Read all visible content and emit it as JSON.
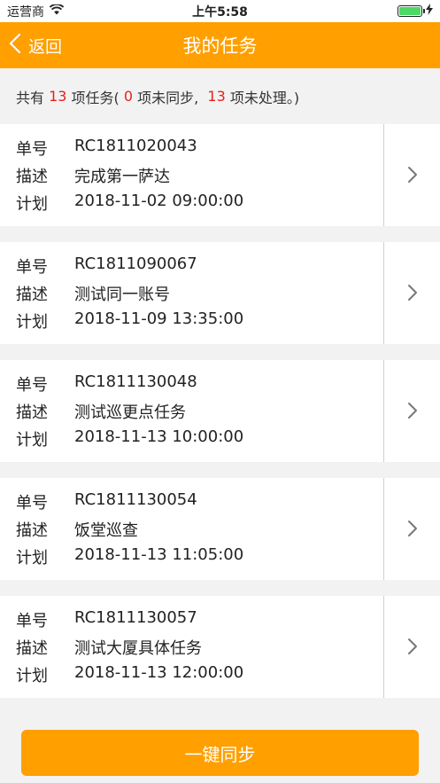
{
  "status_bar": {
    "carrier": "运营商",
    "time": "上午5:58"
  },
  "nav": {
    "back_label": "返回",
    "title": "我的任务"
  },
  "summary": {
    "prefix": "共有 ",
    "total": "13",
    "mid1": " 项任务( ",
    "unsynced": "0",
    "mid2": " 项未同步,  ",
    "unprocessed": "13",
    "suffix": " 项未处理。)"
  },
  "labels": {
    "number": "单号",
    "desc": "描述",
    "plan": "计划"
  },
  "tasks": [
    {
      "number": "RC1811020043",
      "desc": "完成第一萨达",
      "plan": "2018-11-02 09:00:00"
    },
    {
      "number": "RC1811090067",
      "desc": "测试同一账号",
      "plan": "2018-11-09 13:35:00"
    },
    {
      "number": "RC1811130048",
      "desc": "测试巡更点任务",
      "plan": "2018-11-13 10:00:00"
    },
    {
      "number": "RC1811130054",
      "desc": "饭堂巡查",
      "plan": "2018-11-13 11:05:00"
    },
    {
      "number": "RC1811130057",
      "desc": "测试大厦具体任务",
      "plan": "2018-11-13 12:00:00"
    }
  ],
  "sync_button": {
    "label": "一键同步"
  },
  "colors": {
    "accent": "#ff9f00",
    "highlight": "#e5211c"
  }
}
